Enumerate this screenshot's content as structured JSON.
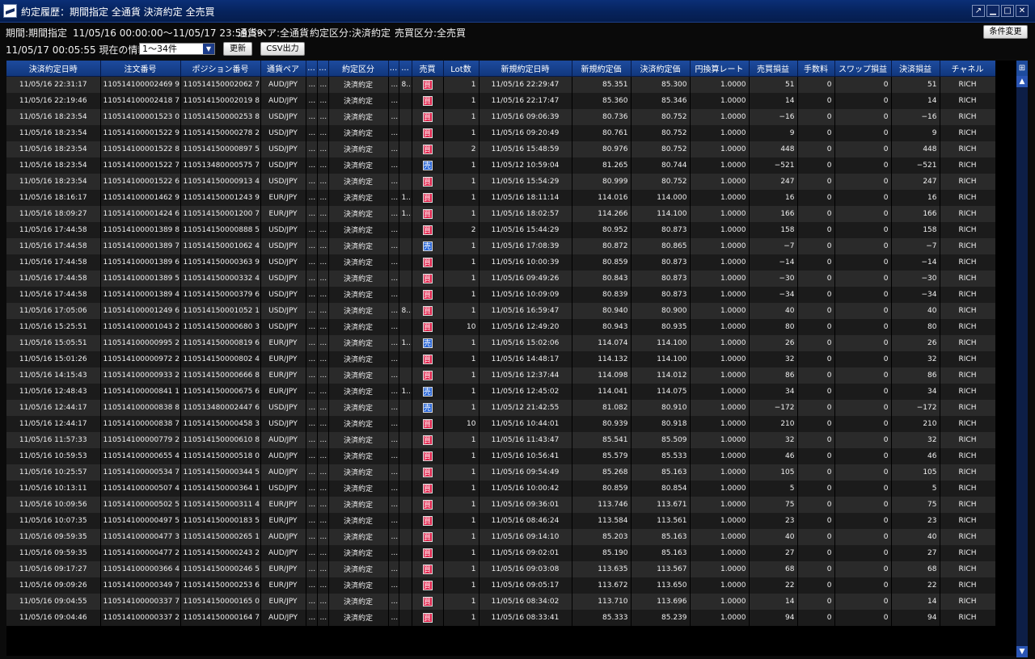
{
  "window": {
    "title": "約定履歴：期間指定 全通貨 決済約定 全売買",
    "icons": [
      "pin-icon",
      "minimize-icon",
      "maximize-icon",
      "close-icon"
    ]
  },
  "filter": {
    "period_label": "期間:期間指定",
    "period_value": "11/05/16 00:00:00～11/05/17 23:59:59",
    "pair_filter": "通貨ペア:全通貨",
    "trade_type_filter": "約定区分:決済約定",
    "side_filter": "売買区分:全売買",
    "change_button": "条件変更"
  },
  "status": {
    "current_info": "11/05/17 00:05:55 現在の情報",
    "page_range": "1～34件",
    "refresh_button": "更新",
    "csv_button": "CSV出力"
  },
  "table": {
    "columns": [
      "決済約定日時",
      "注文番号",
      "ポジション番号",
      "通貨ペア",
      "...",
      "...",
      "約定区分",
      "...",
      "...",
      "売買",
      "Lot数",
      "新規約定日時",
      "新規約定価",
      "決済約定価",
      "円換算レート",
      "売買損益",
      "手数料",
      "スワップ損益",
      "決済損益",
      "チャネル"
    ],
    "rows": [
      [
        "11/05/16 22:31:17",
        "110514100002469 9",
        "110514150002062 7",
        "AUD/JPY",
        "...",
        "...",
        "決済約定",
        "...",
        "8...",
        "買",
        "1",
        "11/05/16 22:29:47",
        "85.351",
        "85.300",
        "1.0000",
        "51",
        "0",
        "0",
        "51",
        "RICH"
      ],
      [
        "11/05/16 22:19:46",
        "110514100002418 7",
        "110514150002019 8",
        "AUD/JPY",
        "...",
        "...",
        "決済約定",
        "...",
        "",
        "買",
        "1",
        "11/05/16 22:17:47",
        "85.360",
        "85.346",
        "1.0000",
        "14",
        "0",
        "0",
        "14",
        "RICH"
      ],
      [
        "11/05/16 18:23:54",
        "110514100001523 0",
        "110514150000253 8",
        "USD/JPY",
        "...",
        "...",
        "決済約定",
        "...",
        "",
        "買",
        "1",
        "11/05/16 09:06:39",
        "80.736",
        "80.752",
        "1.0000",
        "−16",
        "0",
        "0",
        "−16",
        "RICH"
      ],
      [
        "11/05/16 18:23:54",
        "110514100001522 9",
        "110514150000278 2",
        "USD/JPY",
        "...",
        "...",
        "決済約定",
        "...",
        "",
        "買",
        "1",
        "11/05/16 09:20:49",
        "80.761",
        "80.752",
        "1.0000",
        "9",
        "0",
        "0",
        "9",
        "RICH"
      ],
      [
        "11/05/16 18:23:54",
        "110514100001522 8",
        "110514150000897 5",
        "USD/JPY",
        "...",
        "...",
        "決済約定",
        "...",
        "",
        "買",
        "2",
        "11/05/16 15:48:59",
        "80.976",
        "80.752",
        "1.0000",
        "448",
        "0",
        "0",
        "448",
        "RICH"
      ],
      [
        "11/05/16 18:23:54",
        "110514100001522 7",
        "110513480000575 7",
        "USD/JPY",
        "...",
        "...",
        "決済約定",
        "...",
        "",
        "売",
        "1",
        "11/05/12 10:59:04",
        "81.265",
        "80.744",
        "1.0000",
        "−521",
        "0",
        "0",
        "−521",
        "RICH"
      ],
      [
        "11/05/16 18:23:54",
        "110514100001522 6",
        "110514150000913 4",
        "USD/JPY",
        "...",
        "...",
        "決済約定",
        "...",
        "",
        "買",
        "1",
        "11/05/16 15:54:29",
        "80.999",
        "80.752",
        "1.0000",
        "247",
        "0",
        "0",
        "247",
        "RICH"
      ],
      [
        "11/05/16 18:16:17",
        "110514100001462 9",
        "110514150001243 9",
        "EUR/JPY",
        "...",
        "...",
        "決済約定",
        "...",
        "1...",
        "買",
        "1",
        "11/05/16 18:11:14",
        "114.016",
        "114.000",
        "1.0000",
        "16",
        "0",
        "0",
        "16",
        "RICH"
      ],
      [
        "11/05/16 18:09:27",
        "110514100001424 6",
        "110514150001200 7",
        "EUR/JPY",
        "...",
        "...",
        "決済約定",
        "...",
        "1...",
        "買",
        "1",
        "11/05/16 18:02:57",
        "114.266",
        "114.100",
        "1.0000",
        "166",
        "0",
        "0",
        "166",
        "RICH"
      ],
      [
        "11/05/16 17:44:58",
        "110514100001389 8",
        "110514150000888 5",
        "USD/JPY",
        "...",
        "...",
        "決済約定",
        "...",
        "",
        "買",
        "2",
        "11/05/16 15:44:29",
        "80.952",
        "80.873",
        "1.0000",
        "158",
        "0",
        "0",
        "158",
        "RICH"
      ],
      [
        "11/05/16 17:44:58",
        "110514100001389 7",
        "110514150001062 4",
        "USD/JPY",
        "...",
        "...",
        "決済約定",
        "...",
        "",
        "売",
        "1",
        "11/05/16 17:08:39",
        "80.872",
        "80.865",
        "1.0000",
        "−7",
        "0",
        "0",
        "−7",
        "RICH"
      ],
      [
        "11/05/16 17:44:58",
        "110514100001389 6",
        "110514150000363 9",
        "USD/JPY",
        "...",
        "...",
        "決済約定",
        "...",
        "",
        "買",
        "1",
        "11/05/16 10:00:39",
        "80.859",
        "80.873",
        "1.0000",
        "−14",
        "0",
        "0",
        "−14",
        "RICH"
      ],
      [
        "11/05/16 17:44:58",
        "110514100001389 5",
        "110514150000332 4",
        "USD/JPY",
        "...",
        "...",
        "決済約定",
        "...",
        "",
        "買",
        "1",
        "11/05/16 09:49:26",
        "80.843",
        "80.873",
        "1.0000",
        "−30",
        "0",
        "0",
        "−30",
        "RICH"
      ],
      [
        "11/05/16 17:44:58",
        "110514100001389 4",
        "110514150000379 6",
        "USD/JPY",
        "...",
        "...",
        "決済約定",
        "...",
        "",
        "買",
        "1",
        "11/05/16 10:09:09",
        "80.839",
        "80.873",
        "1.0000",
        "−34",
        "0",
        "0",
        "−34",
        "RICH"
      ],
      [
        "11/05/16 17:05:06",
        "110514100001249 6",
        "110514150001052 1",
        "USD/JPY",
        "...",
        "...",
        "決済約定",
        "...",
        "8...",
        "買",
        "1",
        "11/05/16 16:59:47",
        "80.940",
        "80.900",
        "1.0000",
        "40",
        "0",
        "0",
        "40",
        "RICH"
      ],
      [
        "11/05/16 15:25:51",
        "110514100001043 2",
        "110514150000680 3",
        "USD/JPY",
        "...",
        "...",
        "決済約定",
        "...",
        "",
        "買",
        "10",
        "11/05/16 12:49:20",
        "80.943",
        "80.935",
        "1.0000",
        "80",
        "0",
        "0",
        "80",
        "RICH"
      ],
      [
        "11/05/16 15:05:51",
        "110514100000995 2",
        "110514150000819 6",
        "EUR/JPY",
        "...",
        "...",
        "決済約定",
        "...",
        "1...",
        "売",
        "1",
        "11/05/16 15:02:06",
        "114.074",
        "114.100",
        "1.0000",
        "26",
        "0",
        "0",
        "26",
        "RICH"
      ],
      [
        "11/05/16 15:01:26",
        "110514100000972 2",
        "110514150000802 4",
        "EUR/JPY",
        "...",
        "...",
        "決済約定",
        "...",
        "",
        "買",
        "1",
        "11/05/16 14:48:17",
        "114.132",
        "114.100",
        "1.0000",
        "32",
        "0",
        "0",
        "32",
        "RICH"
      ],
      [
        "11/05/16 14:15:43",
        "110514100000933 2",
        "110514150000666 8",
        "EUR/JPY",
        "...",
        "...",
        "決済約定",
        "...",
        "",
        "買",
        "1",
        "11/05/16 12:37:44",
        "114.098",
        "114.012",
        "1.0000",
        "86",
        "0",
        "0",
        "86",
        "RICH"
      ],
      [
        "11/05/16 12:48:43",
        "110514100000841 1",
        "110514150000675 6",
        "EUR/JPY",
        "...",
        "...",
        "決済約定",
        "...",
        "1...",
        "売",
        "1",
        "11/05/16 12:45:02",
        "114.041",
        "114.075",
        "1.0000",
        "34",
        "0",
        "0",
        "34",
        "RICH"
      ],
      [
        "11/05/16 12:44:17",
        "110514100000838 8",
        "110513480002447 6",
        "USD/JPY",
        "...",
        "...",
        "決済約定",
        "...",
        "",
        "売",
        "1",
        "11/05/12 21:42:55",
        "81.082",
        "80.910",
        "1.0000",
        "−172",
        "0",
        "0",
        "−172",
        "RICH"
      ],
      [
        "11/05/16 12:44:17",
        "110514100000838 7",
        "110514150000458 3",
        "USD/JPY",
        "...",
        "...",
        "決済約定",
        "...",
        "",
        "買",
        "10",
        "11/05/16 10:44:01",
        "80.939",
        "80.918",
        "1.0000",
        "210",
        "0",
        "0",
        "210",
        "RICH"
      ],
      [
        "11/05/16 11:57:33",
        "110514100000779 2",
        "110514150000610 8",
        "AUD/JPY",
        "...",
        "...",
        "決済約定",
        "...",
        "",
        "買",
        "1",
        "11/05/16 11:43:47",
        "85.541",
        "85.509",
        "1.0000",
        "32",
        "0",
        "0",
        "32",
        "RICH"
      ],
      [
        "11/05/16 10:59:53",
        "110514100000655 4",
        "110514150000518 0",
        "AUD/JPY",
        "...",
        "...",
        "決済約定",
        "...",
        "",
        "買",
        "1",
        "11/05/16 10:56:41",
        "85.579",
        "85.533",
        "1.0000",
        "46",
        "0",
        "0",
        "46",
        "RICH"
      ],
      [
        "11/05/16 10:25:57",
        "110514100000534 7",
        "110514150000344 5",
        "AUD/JPY",
        "...",
        "...",
        "決済約定",
        "...",
        "",
        "買",
        "1",
        "11/05/16 09:54:49",
        "85.268",
        "85.163",
        "1.0000",
        "105",
        "0",
        "0",
        "105",
        "RICH"
      ],
      [
        "11/05/16 10:13:11",
        "110514100000507 4",
        "110514150000364 1",
        "USD/JPY",
        "...",
        "...",
        "決済約定",
        "...",
        "",
        "買",
        "1",
        "11/05/16 10:00:42",
        "80.859",
        "80.854",
        "1.0000",
        "5",
        "0",
        "0",
        "5",
        "RICH"
      ],
      [
        "11/05/16 10:09:56",
        "110514100000502 5",
        "110514150000311 4",
        "EUR/JPY",
        "...",
        "...",
        "決済約定",
        "...",
        "",
        "買",
        "1",
        "11/05/16 09:36:01",
        "113.746",
        "113.671",
        "1.0000",
        "75",
        "0",
        "0",
        "75",
        "RICH"
      ],
      [
        "11/05/16 10:07:35",
        "110514100000497 5",
        "110514150000183 5",
        "EUR/JPY",
        "...",
        "...",
        "決済約定",
        "...",
        "",
        "買",
        "1",
        "11/05/16 08:46:24",
        "113.584",
        "113.561",
        "1.0000",
        "23",
        "0",
        "0",
        "23",
        "RICH"
      ],
      [
        "11/05/16 09:59:35",
        "110514100000477 3",
        "110514150000265 1",
        "AUD/JPY",
        "...",
        "...",
        "決済約定",
        "...",
        "",
        "買",
        "1",
        "11/05/16 09:14:10",
        "85.203",
        "85.163",
        "1.0000",
        "40",
        "0",
        "0",
        "40",
        "RICH"
      ],
      [
        "11/05/16 09:59:35",
        "110514100000477 2",
        "110514150000243 2",
        "AUD/JPY",
        "...",
        "...",
        "決済約定",
        "...",
        "",
        "買",
        "1",
        "11/05/16 09:02:01",
        "85.190",
        "85.163",
        "1.0000",
        "27",
        "0",
        "0",
        "27",
        "RICH"
      ],
      [
        "11/05/16 09:17:27",
        "110514100000366 4",
        "110514150000246 5",
        "EUR/JPY",
        "...",
        "...",
        "決済約定",
        "...",
        "",
        "買",
        "1",
        "11/05/16 09:03:08",
        "113.635",
        "113.567",
        "1.0000",
        "68",
        "0",
        "0",
        "68",
        "RICH"
      ],
      [
        "11/05/16 09:09:26",
        "110514100000349 7",
        "110514150000253 6",
        "EUR/JPY",
        "...",
        "...",
        "決済約定",
        "...",
        "",
        "買",
        "1",
        "11/05/16 09:05:17",
        "113.672",
        "113.650",
        "1.0000",
        "22",
        "0",
        "0",
        "22",
        "RICH"
      ],
      [
        "11/05/16 09:04:55",
        "110514100000337 7",
        "110514150000165 0",
        "EUR/JPY",
        "...",
        "...",
        "決済約定",
        "...",
        "",
        "買",
        "1",
        "11/05/16 08:34:02",
        "113.710",
        "113.696",
        "1.0000",
        "14",
        "0",
        "0",
        "14",
        "RICH"
      ],
      [
        "11/05/16 09:04:46",
        "110514100000337 2",
        "110514150000164 7",
        "AUD/JPY",
        "...",
        "...",
        "決済約定",
        "...",
        "",
        "買",
        "1",
        "11/05/16 08:33:41",
        "85.333",
        "85.239",
        "1.0000",
        "94",
        "0",
        "0",
        "94",
        "RICH"
      ]
    ]
  },
  "colors": {
    "pair": "#f0a820",
    "negative": "#ff2a3a",
    "buy_badge": "#e0214a",
    "sell_badge": "#2563d6",
    "header": "#1d4b9e"
  }
}
